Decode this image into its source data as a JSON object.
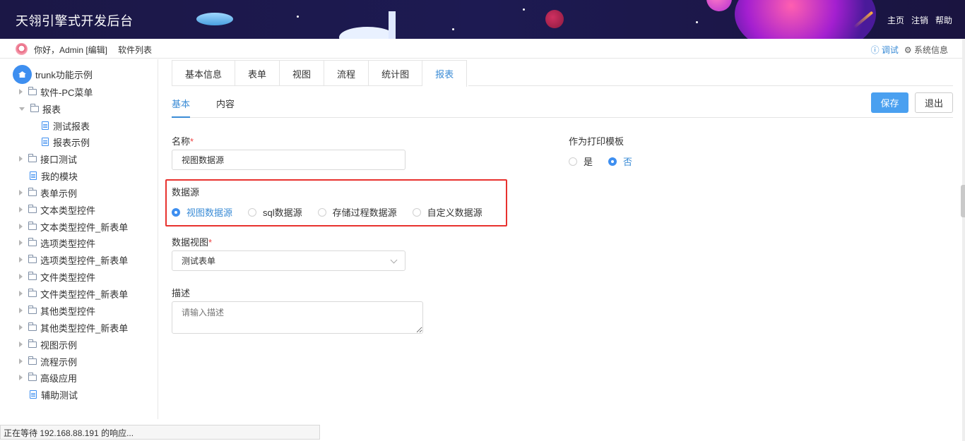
{
  "header": {
    "title": "天翎引擎式开发后台",
    "links": [
      "主页",
      "注销",
      "帮助"
    ]
  },
  "subbar": {
    "greeting": "你好，Admin [编辑]",
    "software_list": "软件列表",
    "debug": "ⓘ 调试",
    "sysinfo": "⚙ 系统信息"
  },
  "sidebar": {
    "root": "trunk功能示例",
    "items": [
      {
        "label": "软件-PC菜单",
        "type": "folder",
        "expanded": false
      },
      {
        "label": "报表",
        "type": "folder",
        "expanded": true
      },
      {
        "label": "测试报表",
        "type": "doc"
      },
      {
        "label": "报表示例",
        "type": "doc"
      },
      {
        "label": "接口测试",
        "type": "folder",
        "expanded": false
      },
      {
        "label": "我的模块",
        "type": "doc"
      },
      {
        "label": "表单示例",
        "type": "folder",
        "expanded": false
      },
      {
        "label": "文本类型控件",
        "type": "folder",
        "expanded": false
      },
      {
        "label": "文本类型控件_新表单",
        "type": "folder",
        "expanded": false
      },
      {
        "label": "选项类型控件",
        "type": "folder",
        "expanded": false
      },
      {
        "label": "选项类型控件_新表单",
        "type": "folder",
        "expanded": false
      },
      {
        "label": "文件类型控件",
        "type": "folder",
        "expanded": false
      },
      {
        "label": "文件类型控件_新表单",
        "type": "folder",
        "expanded": false
      },
      {
        "label": "其他类型控件",
        "type": "folder",
        "expanded": false
      },
      {
        "label": "其他类型控件_新表单",
        "type": "folder",
        "expanded": false
      },
      {
        "label": "视图示例",
        "type": "folder",
        "expanded": false
      },
      {
        "label": "流程示例",
        "type": "folder",
        "expanded": false
      },
      {
        "label": "高级应用",
        "type": "folder",
        "expanded": false
      },
      {
        "label": "辅助测试",
        "type": "doc"
      }
    ]
  },
  "tabs": {
    "items": [
      "基本信息",
      "表单",
      "视图",
      "流程",
      "统计图",
      "报表"
    ],
    "active": "报表"
  },
  "subtabs": {
    "items": [
      "基本",
      "内容"
    ],
    "active": "基本"
  },
  "actions": {
    "save": "保存",
    "exit": "退出"
  },
  "form": {
    "name_label": "名称",
    "required_mark": "*",
    "name_value": "视图数据源",
    "print_template_label": "作为打印模板",
    "print_template_options": [
      "是",
      "否"
    ],
    "print_template_selected": "否",
    "datasource_label": "数据源",
    "datasource_options": [
      "视图数据源",
      "sql数据源",
      "存储过程数据源",
      "自定义数据源"
    ],
    "datasource_selected": "视图数据源",
    "dataview_label": "数据视图",
    "dataview_value": "测试表单",
    "desc_label": "描述",
    "desc_placeholder": "请输入描述"
  },
  "status": {
    "text": "正在等待 192.168.88.191 的响应..."
  },
  "colors": {
    "accent": "#3b8cd6",
    "save_button": "#4aa0f0",
    "highlight_border": "#e8322e",
    "header_bg": "#1b1746"
  }
}
